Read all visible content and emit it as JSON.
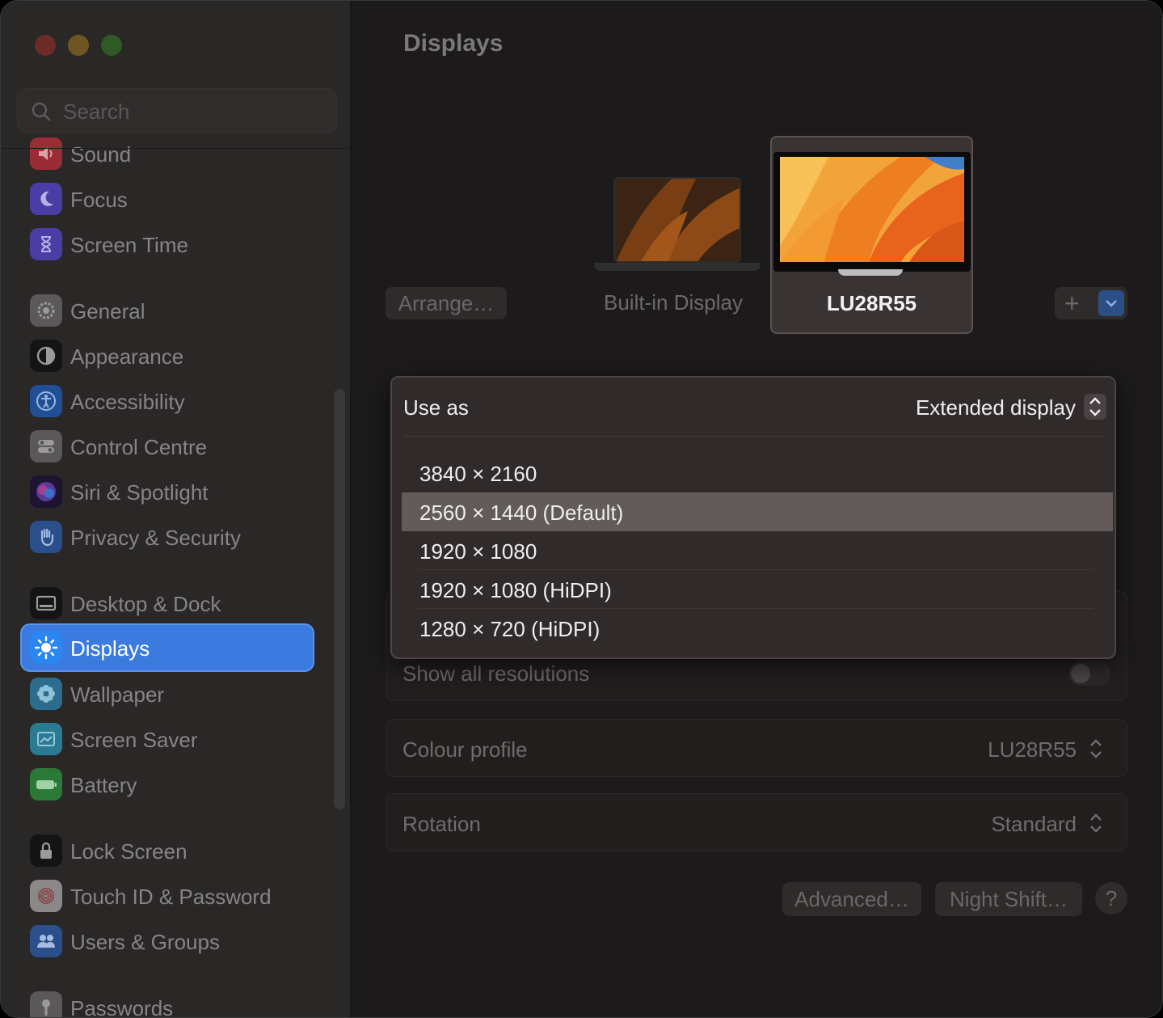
{
  "window": {
    "traffic_lights": [
      "close",
      "minimize",
      "zoom"
    ]
  },
  "sidebar": {
    "search": {
      "placeholder": "Search",
      "value": ""
    },
    "items": [
      {
        "label": "Sound",
        "icon": "speaker-icon",
        "color": "#b8323c"
      },
      {
        "label": "Focus",
        "icon": "moon-icon",
        "color": "#5b4ac8"
      },
      {
        "label": "Screen Time",
        "icon": "hourglass-icon",
        "color": "#5b4ac8"
      },
      {
        "label": "General",
        "icon": "gear-icon",
        "color": "#8e8e93"
      },
      {
        "label": "Appearance",
        "icon": "appearance-icon",
        "color": "#1c1c1c"
      },
      {
        "label": "Accessibility",
        "icon": "accessibility-icon",
        "color": "#1f6fd6"
      },
      {
        "label": "Control Centre",
        "icon": "toggles-icon",
        "color": "#8e8e93"
      },
      {
        "label": "Siri & Spotlight",
        "icon": "siri-icon",
        "color": "#6a3fc0"
      },
      {
        "label": "Privacy & Security",
        "icon": "hand-icon",
        "color": "#2f6fd8"
      },
      {
        "label": "Desktop & Dock",
        "icon": "dock-icon",
        "color": "#1c1c1c"
      },
      {
        "label": "Displays",
        "icon": "sun-icon",
        "color": "#2a86f0"
      },
      {
        "label": "Wallpaper",
        "icon": "flower-icon",
        "color": "#2d9ad0"
      },
      {
        "label": "Screen Saver",
        "icon": "screensaver-icon",
        "color": "#3bb5d8"
      },
      {
        "label": "Battery",
        "icon": "battery-icon",
        "color": "#39a54a"
      },
      {
        "label": "Lock Screen",
        "icon": "lock-icon",
        "color": "#1c1c1c"
      },
      {
        "label": "Touch ID & Password",
        "icon": "fingerprint-icon",
        "color": "#e0e0e0"
      },
      {
        "label": "Users & Groups",
        "icon": "users-icon",
        "color": "#2f6fd8"
      },
      {
        "label": "Passwords",
        "icon": "key-icon",
        "color": "#8e8e93"
      }
    ],
    "active": "Displays"
  },
  "main": {
    "title": "Displays",
    "arrange_label": "Arrange…",
    "displays": [
      {
        "name": "Built-in Display",
        "selected": false
      },
      {
        "name": "LU28R55",
        "selected": true
      }
    ],
    "add_label": "+",
    "use_as": {
      "label": "Use as",
      "value": "Extended display"
    },
    "resolutions": [
      "3840 × 2160",
      "2560 × 1440 (Default)",
      "1920 × 1080",
      "1920 × 1080 (HiDPI)",
      "1280 × 720 (HiDPI)"
    ],
    "selected_resolution": "2560 × 1440 (Default)",
    "show_all_resolutions": {
      "label": "Show all resolutions",
      "on": false
    },
    "colour_profile": {
      "label": "Colour profile",
      "value": "LU28R55"
    },
    "rotation": {
      "label": "Rotation",
      "value": "Standard"
    },
    "buttons": {
      "advanced": "Advanced…",
      "night_shift": "Night Shift…",
      "help": "?"
    }
  },
  "colors": {
    "accent": "#3b7be0",
    "popup_bg": "#312a2a",
    "selected_row": "#635a5a"
  }
}
